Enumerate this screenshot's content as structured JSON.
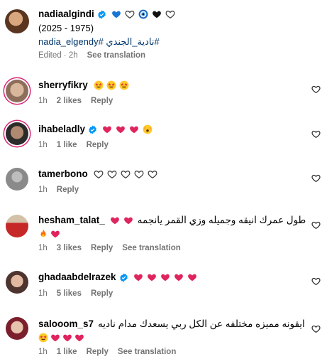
{
  "post": {
    "username": "nadiaalgindi",
    "caption_line1": "(2025 - 1975)",
    "hashtags": "nadia_elgendy# نادية_الجندي#",
    "meta": {
      "edited": "Edited · 2h",
      "see_translation": "See translation"
    }
  },
  "comments": [
    {
      "username": "sherryfikry",
      "text": "",
      "time": "1h",
      "likes": "2 likes",
      "reply": "Reply",
      "see_translation": ""
    },
    {
      "username": "ihabeladly",
      "text": "",
      "time": "1h",
      "likes": "1 like",
      "reply": "Reply",
      "see_translation": ""
    },
    {
      "username": "tamerbono",
      "text": "",
      "time": "1h",
      "likes": "",
      "reply": "Reply",
      "see_translation": ""
    },
    {
      "username": "hesham_talat_",
      "text": "طول عمرك انيقه وجميله وزي القمر يانجمه",
      "time": "1h",
      "likes": "3 likes",
      "reply": "Reply",
      "see_translation": "See translation"
    },
    {
      "username": "ghadaabdelrazek",
      "text": "",
      "time": "1h",
      "likes": "5 likes",
      "reply": "Reply",
      "see_translation": ""
    },
    {
      "username": "salooom_s7",
      "text": "ايقونه مميزه مختلفه عن الكل ربي يسعدك مدام ناديه",
      "time": "1h",
      "likes": "1 like",
      "reply": "Reply",
      "see_translation": "See translation"
    }
  ],
  "colors": {
    "heart_red": "#e0245e",
    "verified_blue": "#0095f6",
    "meta_gray": "#737373",
    "link_blue": "#00376b"
  },
  "icons": [
    "verified-icon",
    "heart-outline-icon",
    "heart-red-icon",
    "heart-blue-icon",
    "evil-eye-icon",
    "heart-black-icon",
    "star-struck-emoji",
    "fire-emoji",
    "raised-hands-emoji"
  ]
}
